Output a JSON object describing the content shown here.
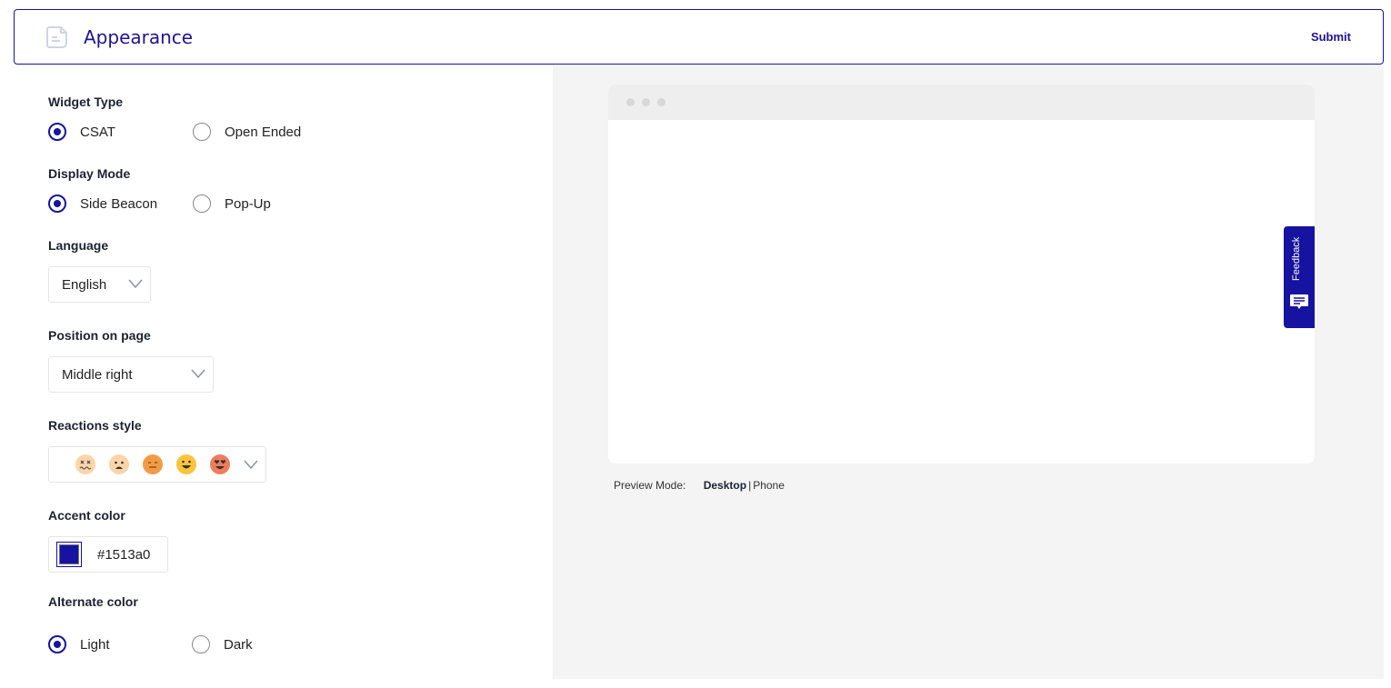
{
  "header": {
    "title": "Appearance",
    "submit_label": "Submit",
    "icon": "document-icon"
  },
  "form": {
    "widget_type": {
      "label": "Widget Type",
      "options": [
        "CSAT",
        "Open Ended"
      ],
      "selected": "CSAT"
    },
    "display_mode": {
      "label": "Display Mode",
      "options": [
        "Side Beacon",
        "Pop-Up"
      ],
      "selected": "Side Beacon"
    },
    "language": {
      "label": "Language",
      "value": "English"
    },
    "position": {
      "label": "Position on page",
      "value": "Middle right"
    },
    "reactions": {
      "label": "Reactions style",
      "faces": [
        "dizzy",
        "sad",
        "neutral",
        "happy",
        "love"
      ]
    },
    "accent": {
      "label": "Accent color",
      "value": "#1513a0"
    },
    "alternate": {
      "label": "Alternate color",
      "options": [
        "Light",
        "Dark"
      ],
      "selected": "Light"
    }
  },
  "preview": {
    "beacon_label": "Feedback",
    "mode_label": "Preview Mode:",
    "desktop": "Desktop",
    "separator": "|",
    "phone": "Phone",
    "selected": "Desktop"
  },
  "colors": {
    "accent": "#1513a0",
    "title": "#1f1396"
  }
}
